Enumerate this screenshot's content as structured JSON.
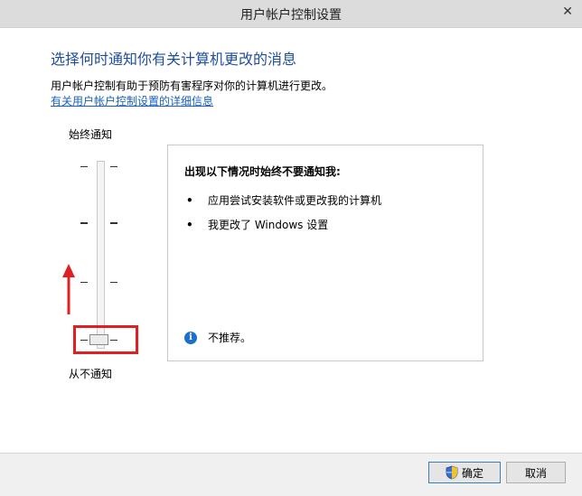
{
  "window": {
    "title": "用户帐户控制设置",
    "close_glyph": "✕"
  },
  "main": {
    "heading": "选择何时通知你有关计算机更改的消息",
    "description": "用户帐户控制有助于预防有害程序对你的计算机进行更改。",
    "link": "有关用户帐户控制设置的详细信息"
  },
  "slider": {
    "top_label": "始终通知",
    "bottom_label": "从不通知",
    "levels": 4,
    "selected_level": 1,
    "selected_level_description": "lowest of 4 (never notify)"
  },
  "panel": {
    "heading": "出现以下情况时始终不要通知我:",
    "items": [
      "应用尝试安装软件或更改我的计算机",
      "我更改了 Windows 设置"
    ],
    "note": "不推荐。",
    "bullet": "•"
  },
  "buttons": {
    "ok": "确定",
    "cancel": "取消"
  },
  "colors": {
    "heading": "#1f4e9c",
    "link": "#1a5fbf",
    "highlight": "#e02020",
    "arrow": "#e02020",
    "info_icon": "#1e6fc9"
  },
  "icons": {
    "info": "info-icon",
    "shield": "uac-shield-icon"
  }
}
